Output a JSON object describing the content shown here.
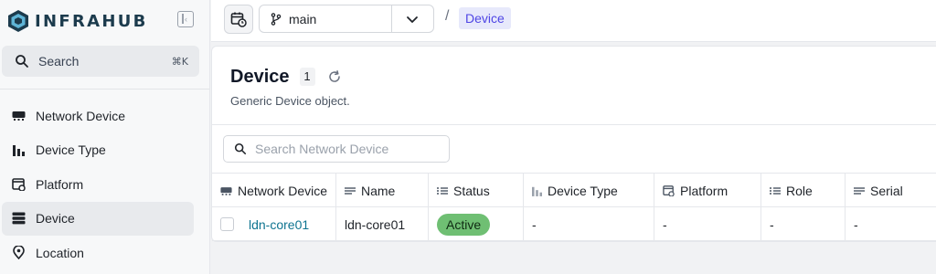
{
  "app": {
    "logo_text": "INFRAHUB"
  },
  "sidebar": {
    "search": {
      "label": "Search",
      "shortcut": "⌘K"
    },
    "items": [
      {
        "label": "Network Device",
        "icon": "network-device-icon"
      },
      {
        "label": "Device Type",
        "icon": "bar-chart-icon"
      },
      {
        "label": "Platform",
        "icon": "platform-icon"
      },
      {
        "label": "Device",
        "icon": "server-icon",
        "active": true
      },
      {
        "label": "Location",
        "icon": "location-pin-icon"
      }
    ]
  },
  "topbar": {
    "branch": "main",
    "breadcrumb_separator": "/",
    "breadcrumb": "Device"
  },
  "page": {
    "title": "Device",
    "count": "1",
    "subtitle": "Generic Device object."
  },
  "table": {
    "search_placeholder": "Search Network Device",
    "columns": [
      {
        "label": "Network Device",
        "icon": "network-device-icon"
      },
      {
        "label": "Name",
        "icon": "text-lines-icon"
      },
      {
        "label": "Status",
        "icon": "list-icon"
      },
      {
        "label": "Device Type",
        "icon": "bar-chart-icon"
      },
      {
        "label": "Platform",
        "icon": "platform-icon"
      },
      {
        "label": "Role",
        "icon": "list-icon"
      },
      {
        "label": "Serial",
        "icon": "text-lines-icon"
      }
    ],
    "rows": [
      {
        "network_device": "ldn-core01",
        "name": "ldn-core01",
        "status": "Active",
        "device_type": "-",
        "platform": "-",
        "role": "-",
        "serial": "-"
      }
    ]
  },
  "colors": {
    "accent": "#4f46e5",
    "link": "#0e7490",
    "status_active": "#6fbf73",
    "logo": "#1c3b4d"
  }
}
